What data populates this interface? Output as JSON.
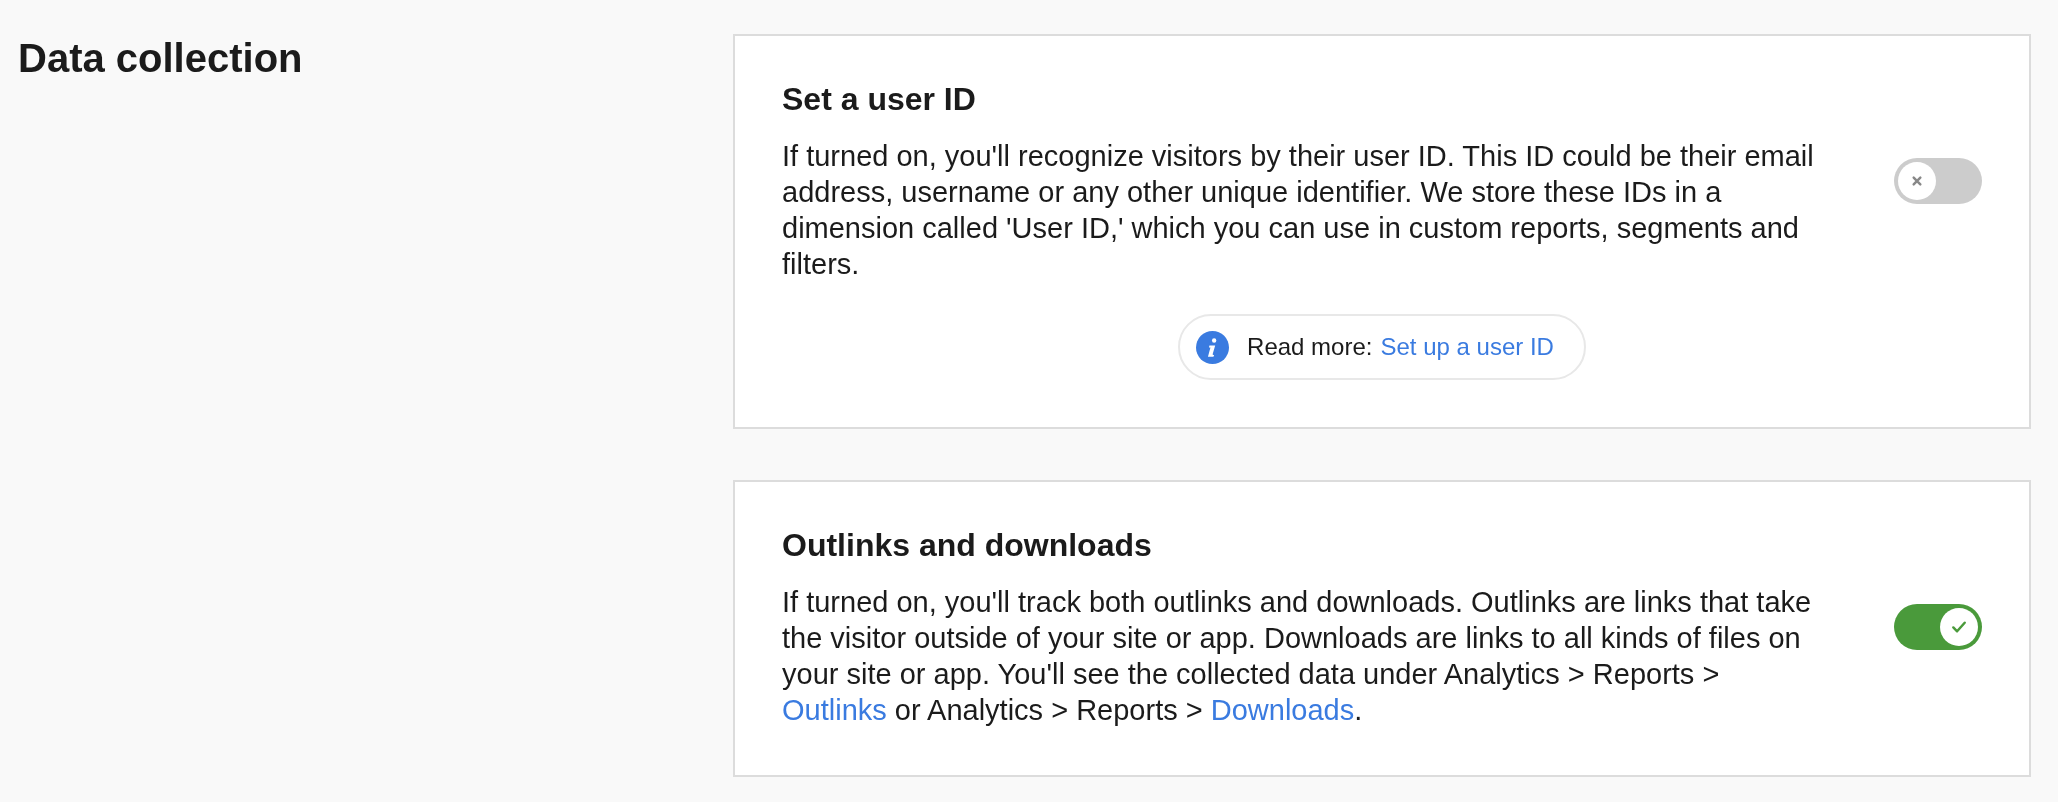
{
  "section": {
    "title": "Data collection"
  },
  "cards": [
    {
      "title": "Set a user ID",
      "description": [
        {
          "kind": "text",
          "text": "If turned on, you'll recognize visitors by their user ID. This ID could be their email address, username or any other unique identifier. We store these IDs in a dimension called 'User ID,' which you can use in custom reports, segments and filters."
        }
      ],
      "toggle": {
        "on": false
      },
      "read_more": {
        "label": "Read more:",
        "link": "Set up a user ID"
      }
    },
    {
      "title": "Outlinks and downloads",
      "description": [
        {
          "kind": "text",
          "text": "If turned on, you'll track both outlinks and downloads. Outlinks are links that take the visitor outside of your site or app. Downloads are links to all kinds of files on your site or app. You'll see the collected data under Analytics > Reports > "
        },
        {
          "kind": "link",
          "text": "Outlinks"
        },
        {
          "kind": "text",
          "text": " or Analytics > Reports > "
        },
        {
          "kind": "link",
          "text": "Downloads"
        },
        {
          "kind": "text",
          "text": "."
        }
      ],
      "toggle": {
        "on": true
      }
    }
  ]
}
